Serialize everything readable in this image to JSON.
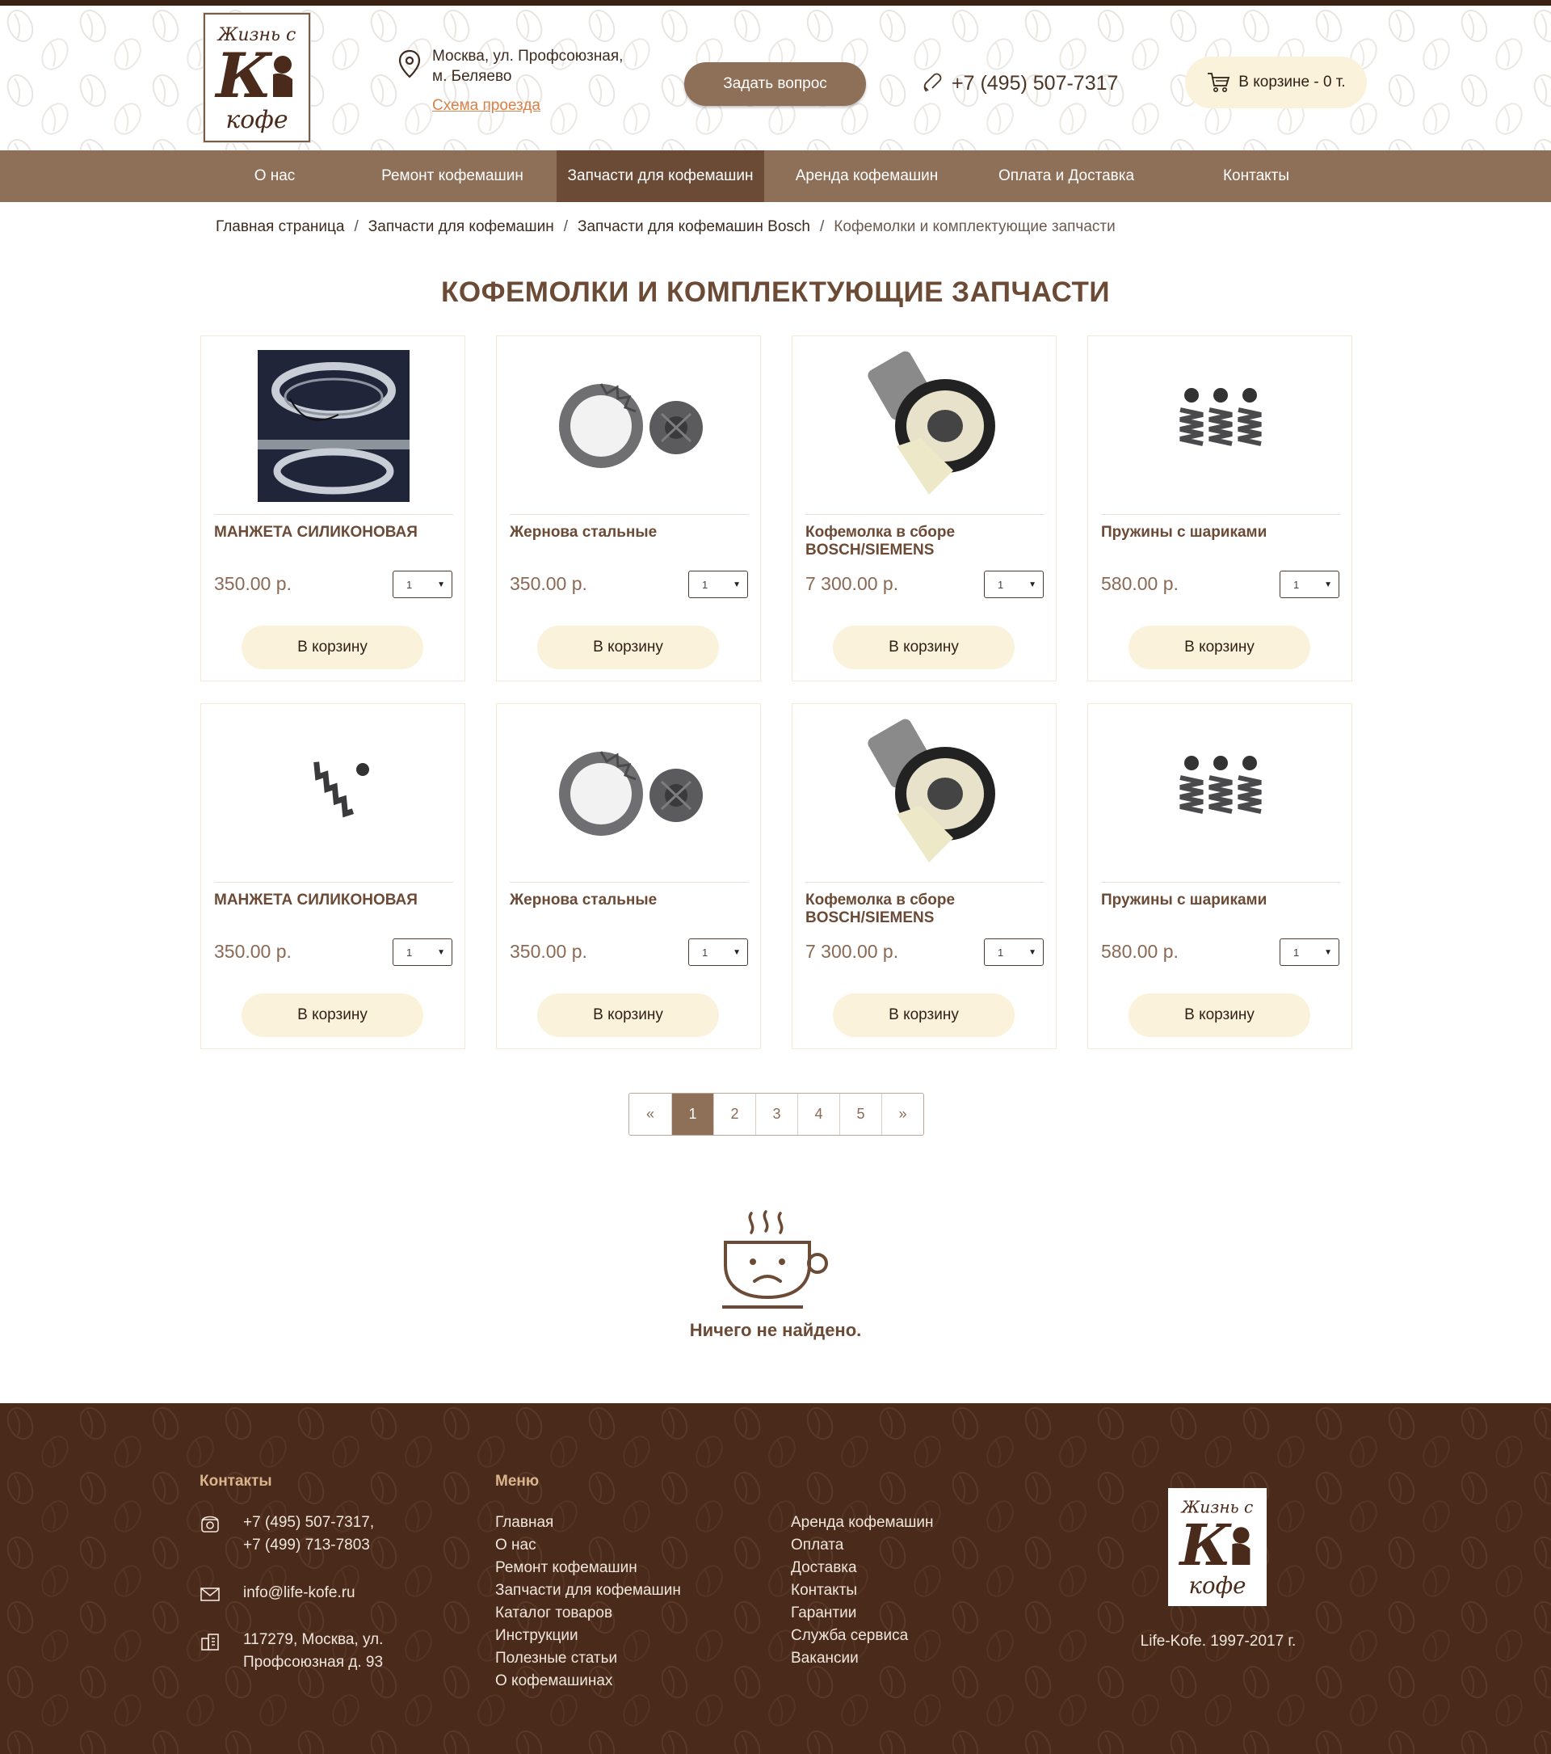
{
  "header": {
    "logo_text": "Жизнь с Кофе",
    "address_line1": "Москва, ул. Профсоюзная,",
    "address_line2": "м. Беляево",
    "route_link": "Схема проезда",
    "ask_button": "Задать вопрос",
    "phone": "+7 (495) 507-7317",
    "cart": "В корзине - 0 т."
  },
  "nav": {
    "items": [
      {
        "label": "О нас"
      },
      {
        "label": "Ремонт кофемашин"
      },
      {
        "label": "Запчасти для кофемашин",
        "active": true
      },
      {
        "label": "Аренда кофемашин"
      },
      {
        "label": "Оплата и Доставка"
      },
      {
        "label": "Контакты"
      }
    ]
  },
  "breadcrumb": {
    "items": [
      "Главная страница",
      "Запчасти для кофемашин",
      "Запчасти для кофемашин Bosch"
    ],
    "separator": "/",
    "current": "Кофемолки и комплектующие запчасти"
  },
  "page_title": "КОФЕМОЛКИ И КОМПЛЕКТУЮЩИЕ ЗАПЧАСТИ",
  "products": [
    {
      "name": "МАНЖЕТА СИЛИКОНОВАЯ",
      "price": "350.00 р.",
      "qty": "1",
      "button": "В корзину",
      "image": "silicone-gasket-photo"
    },
    {
      "name": "Жернова стальные",
      "price": "350.00 р.",
      "qty": "1",
      "button": "В корзину",
      "image": "steel-burrs-photo"
    },
    {
      "name": "Кофемолка в сборе BOSCH/SIEMENS",
      "price": "7 300.00 р.",
      "qty": "1",
      "button": "В корзину",
      "image": "grinder-assembly-photo"
    },
    {
      "name": "Пружины с шариками",
      "price": "580.00 р.",
      "qty": "1",
      "button": "В корзину",
      "image": "springs-balls-photo"
    },
    {
      "name": "МАНЖЕТА СИЛИКОНОВАЯ",
      "price": "350.00 р.",
      "qty": "1",
      "button": "В корзину",
      "image": "spring-ball-photo"
    },
    {
      "name": "Жернова стальные",
      "price": "350.00 р.",
      "qty": "1",
      "button": "В корзину",
      "image": "steel-burrs-photo"
    },
    {
      "name": "Кофемолка в сборе BOSCH/SIEMENS",
      "price": "7 300.00 р.",
      "qty": "1",
      "button": "В корзину",
      "image": "grinder-assembly-photo"
    },
    {
      "name": "Пружины с шариками",
      "price": "580.00 р.",
      "qty": "1",
      "button": "В корзину",
      "image": "springs-balls-photo"
    }
  ],
  "pagination": {
    "prev": "«",
    "pages": [
      "1",
      "2",
      "3",
      "4",
      "5"
    ],
    "current": "1",
    "next": "»"
  },
  "empty_state": {
    "icon": "sad-coffee-cup-icon",
    "message": "Ничего не найдено."
  },
  "footer": {
    "contacts_heading": "Контакты",
    "phone_line1": "+7 (495) 507-7317,",
    "phone_line2": "+7 (499) 713-7803",
    "email": "info@life-kofe.ru",
    "address_line1": "117279, Москва, ул.",
    "address_line2": "Профсоюзная д. 93",
    "menu_heading": "Меню",
    "menu_col1": [
      "Главная",
      "О нас",
      "Ремонт кофемашин",
      "Запчасти для кофемашин",
      "Каталог товаров",
      "Инструкции",
      "Полезные статьи",
      "О кофемашинах"
    ],
    "menu_col2": [
      "Аренда кофемашин",
      "Оплата",
      "Доставка",
      "Контакты",
      "Гарантии",
      "Служба сервиса",
      "Вакансии"
    ],
    "copyright": "Life-Kofe. 1997-2017 г."
  },
  "colors": {
    "brand_brown": "#8e6f58",
    "dark_brown": "#4a2a1a",
    "cream": "#fbf2dc",
    "link_orange": "#d8824a"
  }
}
